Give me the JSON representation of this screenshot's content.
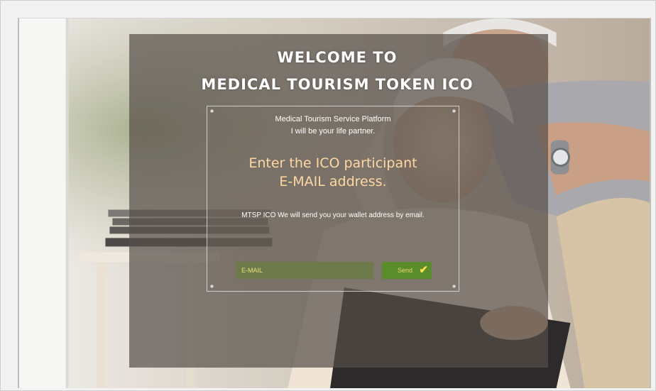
{
  "hero": {
    "welcome_line1": "WELCOME TO",
    "welcome_line2": "MEDICAL TOURISM TOKEN ICO"
  },
  "card": {
    "subtitle_line1": "Medical Tourism Service Platform",
    "subtitle_line2": "I will be your life partner.",
    "headline_line1": "Enter the ICO participant",
    "headline_line2": "E-MAIL address.",
    "note": "MTSP ICO We will send you your wallet address by email."
  },
  "form": {
    "email_placeholder": "E-MAIL",
    "email_value": "",
    "send_label": "Send",
    "send_icon": "check-icon"
  },
  "colors": {
    "headline": "#ffd7a3",
    "input_bg": "#6f7a4a",
    "button_bg": "#5a8c2c",
    "check": "#ffe24a"
  }
}
